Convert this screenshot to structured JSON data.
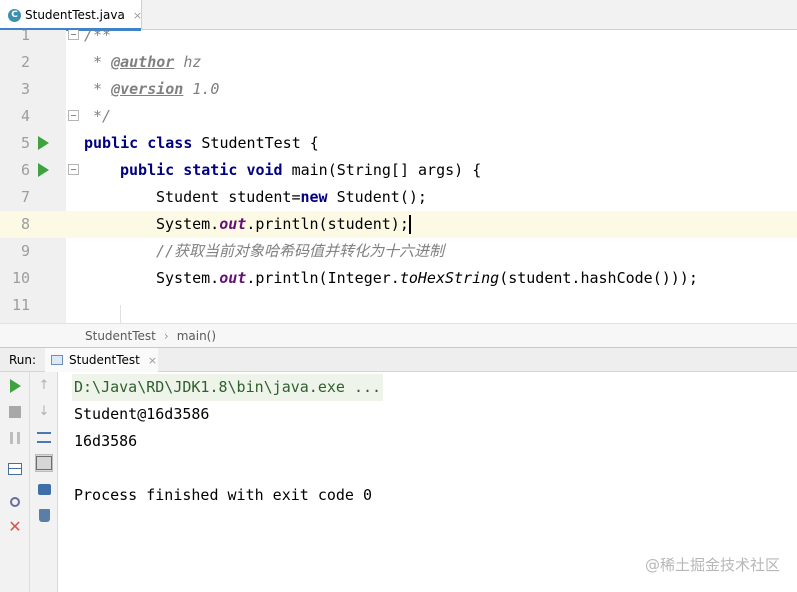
{
  "editor": {
    "tab": {
      "icon_letter": "C",
      "filename": "StudentTest.java",
      "close": "×"
    },
    "lines": [
      {
        "num": "1"
      },
      {
        "num": "2"
      },
      {
        "num": "3"
      },
      {
        "num": "4"
      },
      {
        "num": "5"
      },
      {
        "num": "6"
      },
      {
        "num": "7"
      },
      {
        "num": "8"
      },
      {
        "num": "9"
      },
      {
        "num": "10"
      },
      {
        "num": "11"
      }
    ],
    "code": {
      "l1": "/**",
      "l2_a": " * ",
      "l2_tag": "@author",
      "l2_b": " hz",
      "l3_a": " * ",
      "l3_tag": "@version",
      "l3_b": " 1.0",
      "l4": " */",
      "l5_kw1": "public",
      "l5_kw2": "class",
      "l5_rest": " StudentTest {",
      "l6_kw1": "public",
      "l6_kw2": "static",
      "l6_kw3": "void",
      "l6_rest": " main(String[] args) {",
      "l7_a": "Student student=",
      "l7_kw": "new",
      "l7_b": " Student();",
      "l8_a": "System.",
      "l8_fld": "out",
      "l8_b": ".println(student);",
      "l9": "//获取当前对象哈希码值并转化为十六进制",
      "l10_a": "System.",
      "l10_fld": "out",
      "l10_b": ".println(Integer.",
      "l10_stat": "toHexString",
      "l10_c": "(student.hashCode()));"
    },
    "breadcrumb": {
      "class_name": "StudentTest",
      "separator": "›",
      "method": "main()"
    }
  },
  "run": {
    "label": "Run:",
    "tab_name": "StudentTest",
    "tab_close": "×",
    "console": [
      "D:\\Java\\RD\\JDK1.8\\bin\\java.exe ...",
      "Student@16d3586",
      "16d3586",
      "",
      "Process finished with exit code 0"
    ]
  },
  "watermark": "@稀土掘金技术社区",
  "colors": {
    "keyword": "#000080",
    "comment": "#808080",
    "field": "#660e7a",
    "run_green": "#3ea23e",
    "caret_line": "#fcfae4",
    "tab_underline": "#4083c9"
  }
}
